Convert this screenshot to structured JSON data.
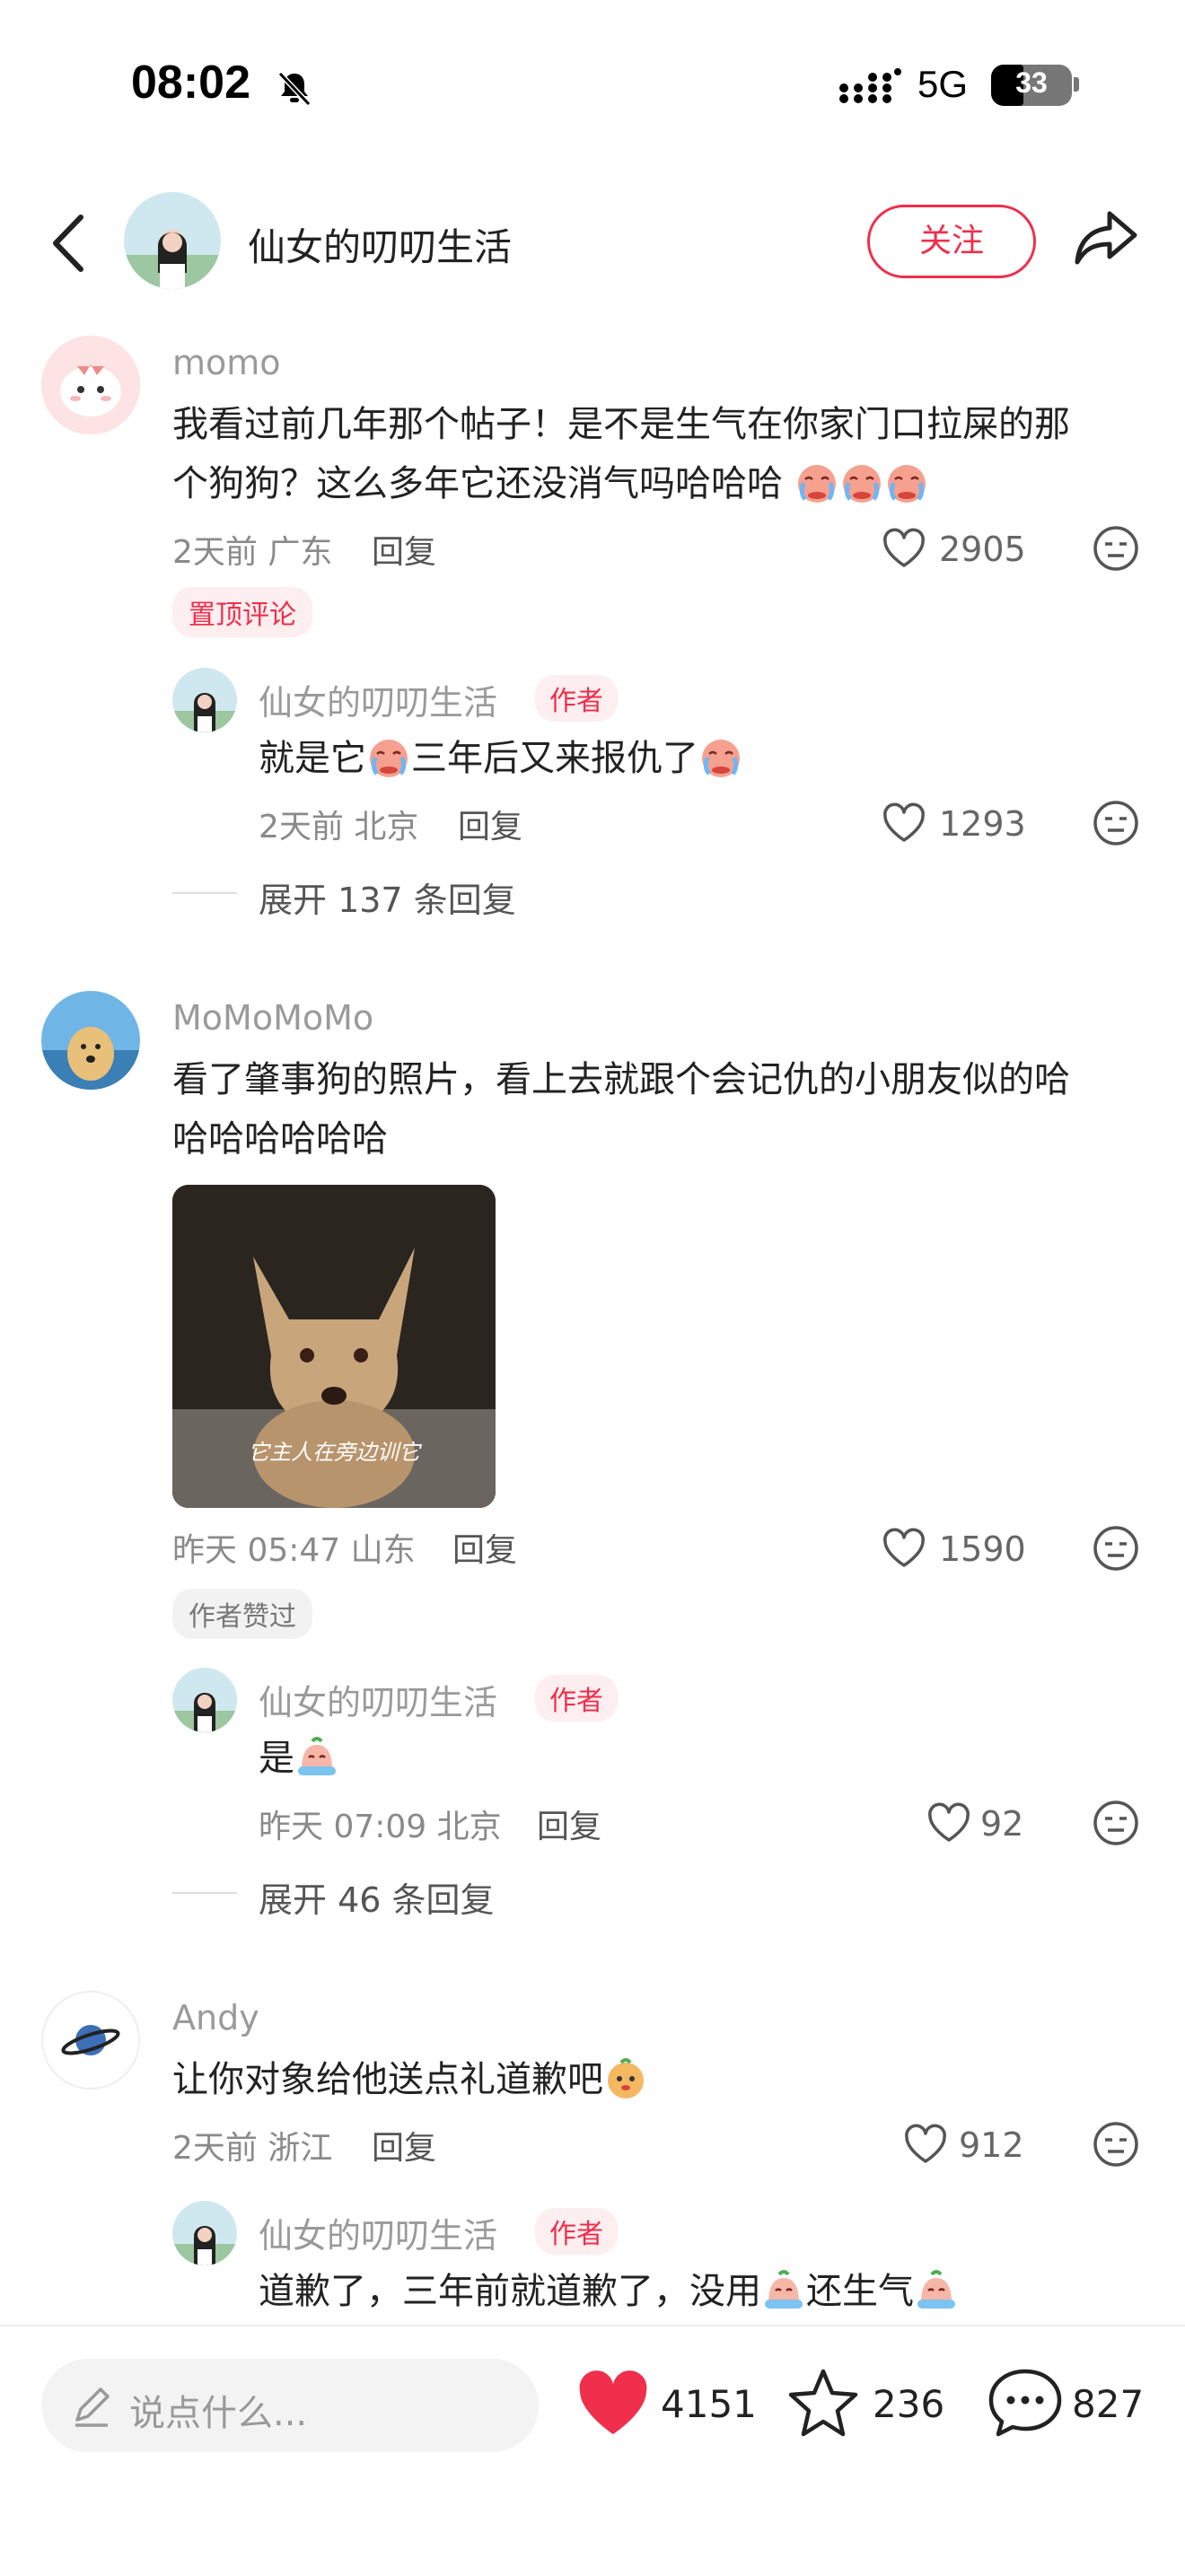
{
  "status_bar": {
    "time": "08:02",
    "network": "5G",
    "battery": "33"
  },
  "header": {
    "title": "仙女的叨叨生活",
    "follow_label": "关注"
  },
  "comments": [
    {
      "user": "momo",
      "text_line1": "我看过前几年那个帖子！是不是生气在你家门口拉屎的那",
      "text_line2": "个狗狗？这么多年它还没消气吗哈哈哈",
      "meta": "2天前 广东",
      "reply_label": "回复",
      "likes": "2905",
      "tag": "置顶评论",
      "sub_reply": {
        "user": "仙女的叨叨生活",
        "badge": "作者",
        "text_a": "就是它",
        "text_b": "三年后又来报仇了",
        "meta": "2天前 北京",
        "reply_label": "回复",
        "likes": "1293"
      },
      "expand": "展开 137 条回复"
    },
    {
      "user": "MoMoMoMo",
      "text_line1": "看了肇事狗的照片，看上去就跟个会记仇的小朋友似的哈",
      "text_line2": "哈哈哈哈哈哈",
      "image_caption": "它主人在旁边训它",
      "meta": "昨天 05:47 山东",
      "reply_label": "回复",
      "likes": "1590",
      "tag": "作者赞过",
      "sub_reply": {
        "user": "仙女的叨叨生活",
        "badge": "作者",
        "text_a": "是",
        "meta": "昨天 07:09 北京",
        "reply_label": "回复",
        "likes": "92"
      },
      "expand": "展开 46 条回复"
    },
    {
      "user": "Andy",
      "text_line1": "让你对象给他送点礼道歉吧",
      "meta": "2天前 浙江",
      "reply_label": "回复",
      "likes": "912",
      "sub_reply": {
        "user": "仙女的叨叨生活",
        "badge": "作者",
        "text_a": "道歉了，三年前就道歉了，没用",
        "text_b": "还生气"
      }
    }
  ],
  "bottom_bar": {
    "input_placeholder": "说点什么...",
    "likes": "4151",
    "stars": "236",
    "comments": "827"
  },
  "colors": {
    "accent": "#ef2f4b",
    "text": "#222222",
    "muted": "#8a8a8a"
  }
}
